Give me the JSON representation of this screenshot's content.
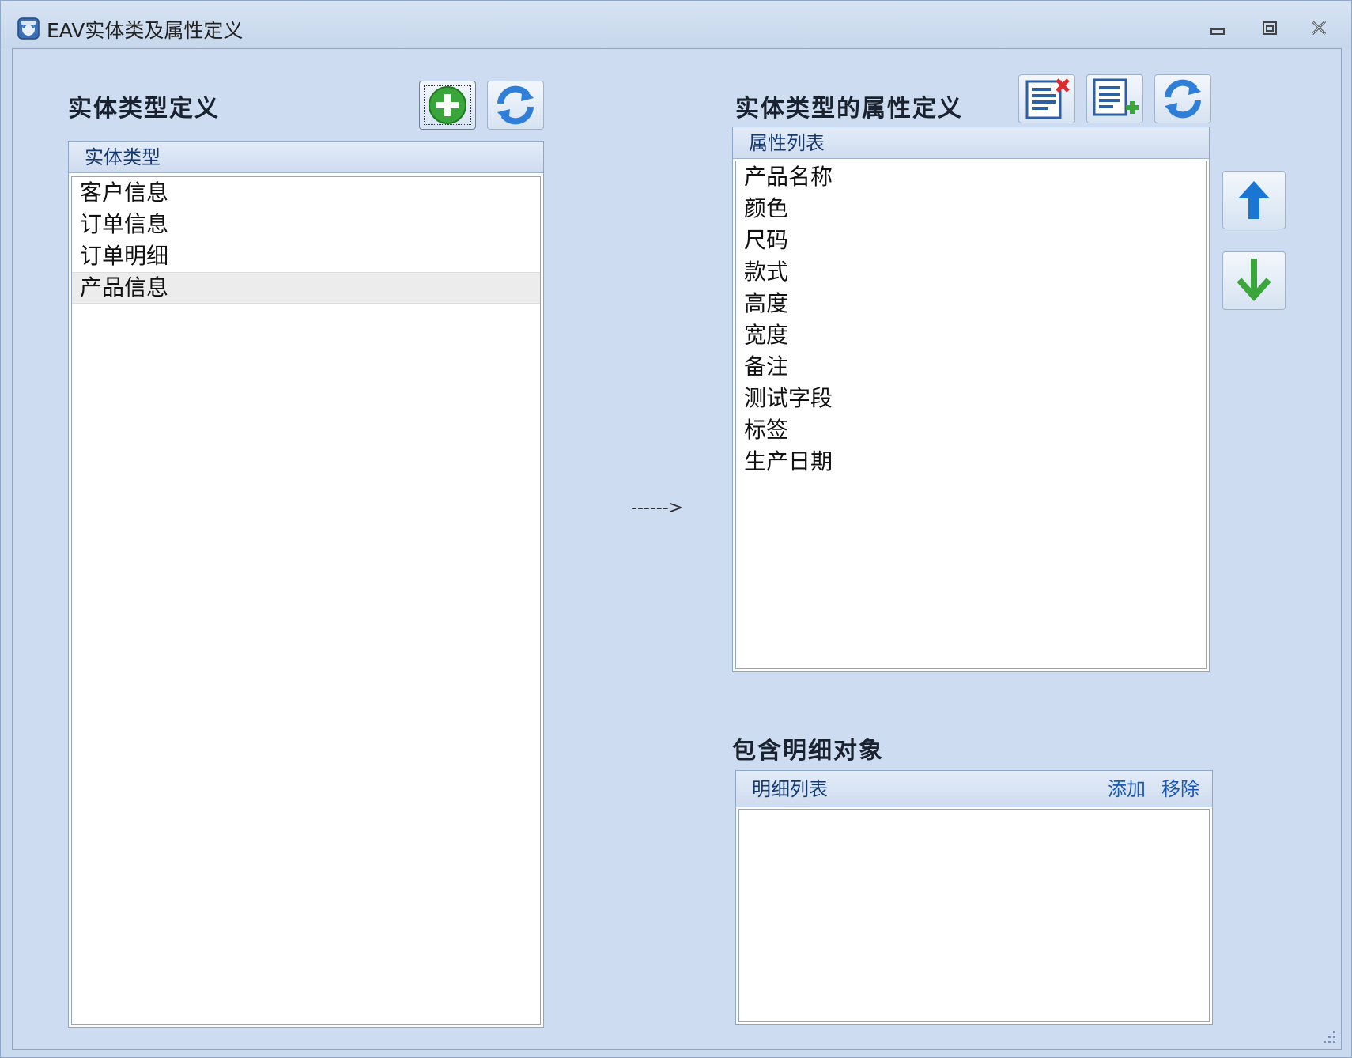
{
  "window": {
    "title": "EAV实体类及属性定义"
  },
  "left": {
    "heading": "实体类型定义",
    "list_header": "实体类型",
    "items": [
      "客户信息",
      "订单信息",
      "订单明细",
      "产品信息"
    ],
    "selected_index": 3
  },
  "arrow_label": "------>",
  "right": {
    "heading": "实体类型的属性定义",
    "list_header": "属性列表",
    "items": [
      "产品名称",
      "颜色",
      "尺码",
      "款式",
      "高度",
      "宽度",
      "备注",
      "测试字段",
      "标签",
      "生产日期"
    ]
  },
  "detail": {
    "heading": "包含明细对象",
    "list_header": "明细列表",
    "add_label": "添加",
    "remove_label": "移除"
  },
  "colors": {
    "accent_blue": "#1a76d2",
    "accent_green": "#3aa53a",
    "danger_red": "#e02b2b"
  }
}
